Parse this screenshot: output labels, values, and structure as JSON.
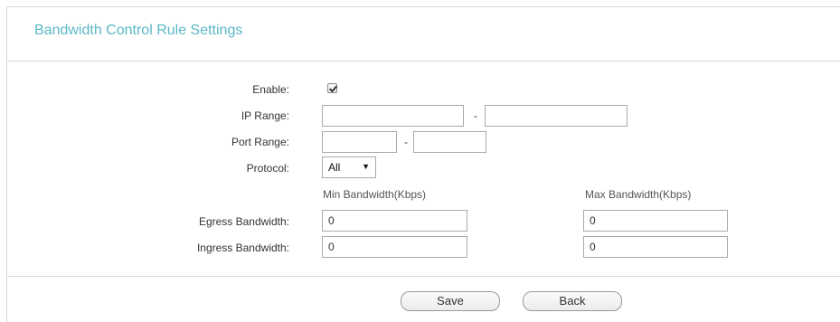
{
  "section": {
    "title": "Bandwidth Control Rule Settings"
  },
  "form": {
    "enable": {
      "label": "Enable:",
      "checked": true
    },
    "ip_range": {
      "label": "IP Range:",
      "start_value": "",
      "end_value": "",
      "separator": "-"
    },
    "port_range": {
      "label": "Port Range:",
      "start_value": "",
      "end_value": "",
      "separator": "-"
    },
    "protocol": {
      "label": "Protocol:",
      "selected": "All"
    },
    "columns": {
      "min": "Min Bandwidth(Kbps)",
      "max": "Max Bandwidth(Kbps)"
    },
    "egress": {
      "label": "Egress Bandwidth:",
      "min_value": "0",
      "max_value": "0"
    },
    "ingress": {
      "label": "Ingress Bandwidth:",
      "min_value": "0",
      "max_value": "0"
    }
  },
  "actions": {
    "save_label": "Save",
    "back_label": "Back"
  },
  "colors": {
    "title": "#5bb8c7",
    "divider": "#d9d9d9",
    "input_border": "#a9a9a9"
  },
  "icons": {
    "checkbox": "checkmark-icon",
    "dropdown": "dropdown-arrow-icon"
  }
}
